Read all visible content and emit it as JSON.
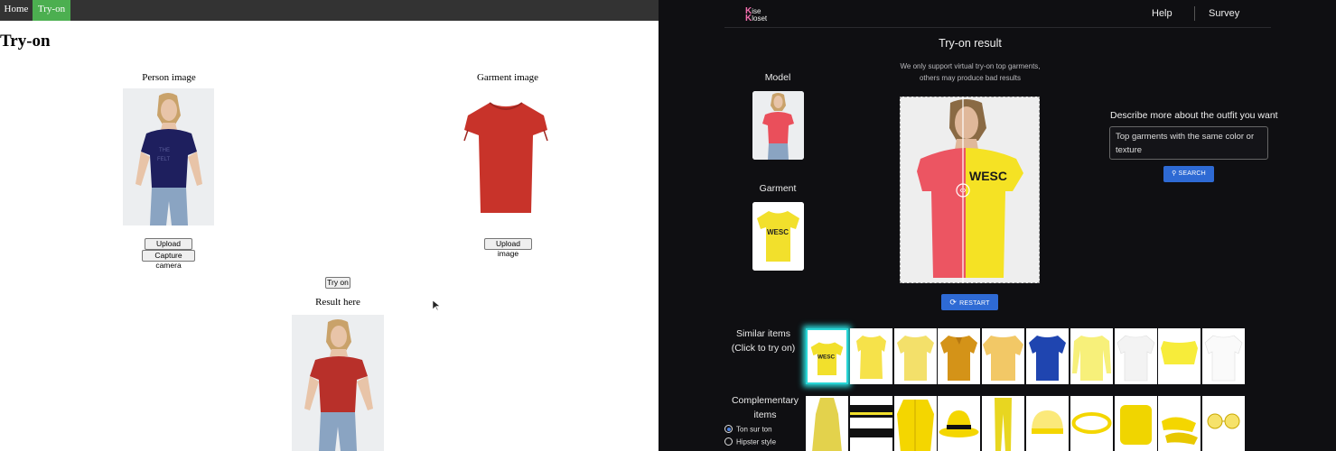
{
  "left": {
    "nav": {
      "home": "Home",
      "tryon": "Try-on"
    },
    "page_title": "Try-on",
    "person_caption": "Person image",
    "garment_caption": "Garment image",
    "upload_person": "Upload image",
    "capture_camera": "Capture camera",
    "upload_garment": "Upload image",
    "tryon_button": "Try on",
    "result_caption": "Result here",
    "colors": {
      "nav_bg": "#333333",
      "active_tab": "#4CAF50"
    }
  },
  "right": {
    "logo_top": "K",
    "logo_top_rest": "ise",
    "logo_bottom": "K",
    "logo_bottom_rest": "loset",
    "help": "Help",
    "survey": "Survey",
    "title": "Try-on result",
    "note_line1": "We only support virtual try-on top garments,",
    "note_line2": "others may produce bad results",
    "model_label": "Model",
    "garment_label": "Garment",
    "restart": "RESTART",
    "describe_label": "Describe more about the outfit you want",
    "describe_value": "Top garments with the same color or texture",
    "search": "SEARCH",
    "similar_line1": "Similar items",
    "similar_line2": "(Click to try on)",
    "comp_line1": "Complementary",
    "comp_line2": "items",
    "radio_1": "Ton sur ton",
    "radio_2": "Hipster style",
    "garment_print": "WESC",
    "colors": {
      "bg": "#0f0f12",
      "accent": "#2e6ad4",
      "selected_glow": "#29d6d6",
      "logo": "#f26fae"
    }
  }
}
